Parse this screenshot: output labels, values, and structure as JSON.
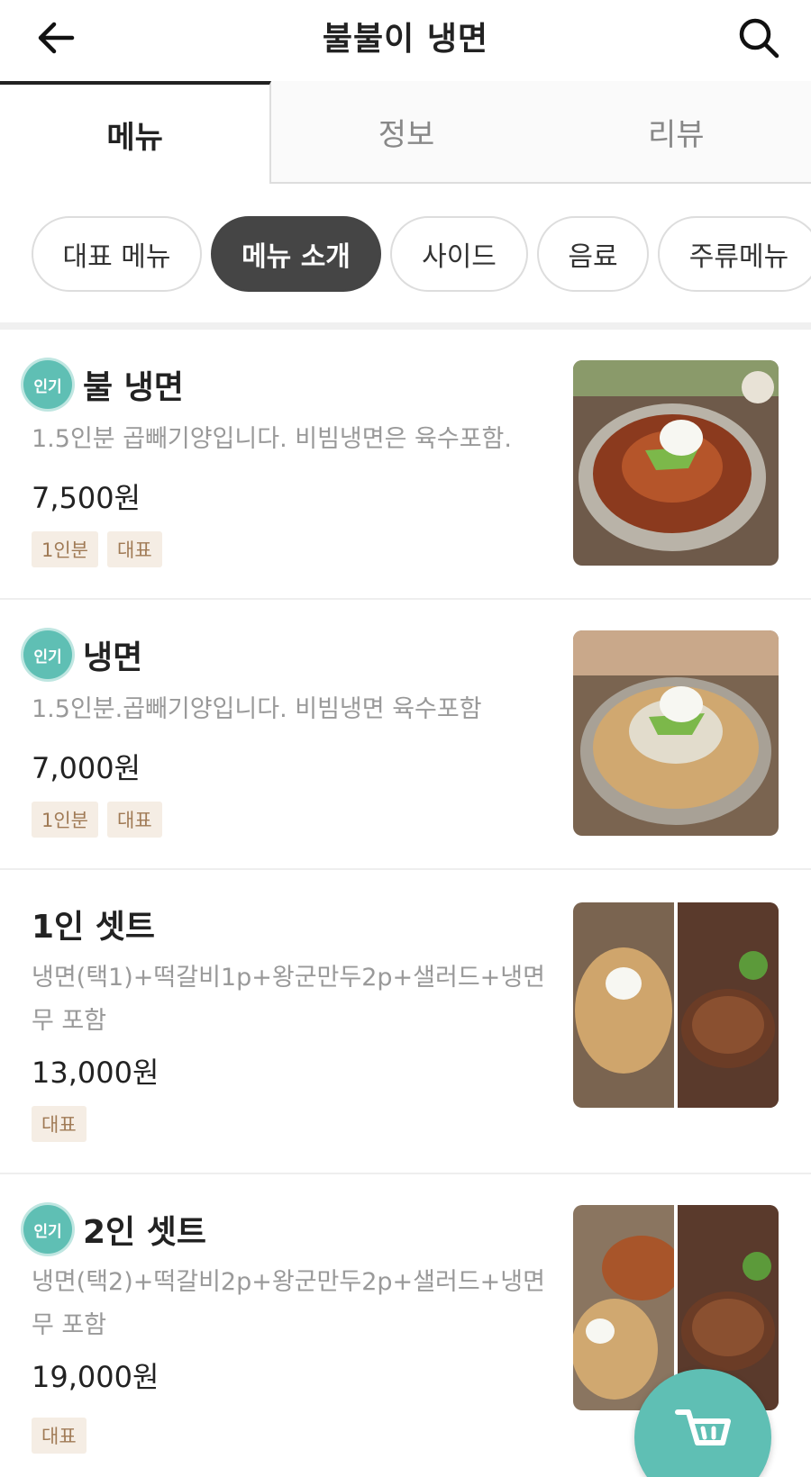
{
  "header": {
    "title": "불불이 냉면",
    "back_icon": "arrow-left-icon",
    "search_icon": "search-icon"
  },
  "tabs": [
    {
      "label": "메뉴",
      "active": true
    },
    {
      "label": "정보",
      "active": false
    },
    {
      "label": "리뷰",
      "active": false
    }
  ],
  "categories": [
    {
      "label": "대표 메뉴",
      "active": false
    },
    {
      "label": "메뉴 소개",
      "active": true
    },
    {
      "label": "사이드",
      "active": false
    },
    {
      "label": "음료",
      "active": false
    },
    {
      "label": "주류메뉴",
      "active": false
    }
  ],
  "colors": {
    "accent": "#5fbfb4",
    "chip_active": "#454545",
    "tag_bg": "#f5ede4",
    "tag_text": "#a07a55"
  },
  "menu": [
    {
      "popular": true,
      "badge": "인기",
      "name": "불 냉면",
      "desc": "1.5인분 곱빼기양입니다. 비빔냉면은 육수포함.",
      "price": "7,500원",
      "tags": [
        "1인분",
        "대표"
      ]
    },
    {
      "popular": true,
      "badge": "인기",
      "name": "냉면",
      "desc": "1.5인분.곱빼기양입니다. 비빔냉면 육수포함",
      "price": "7,000원",
      "tags": [
        "1인분",
        "대표"
      ]
    },
    {
      "popular": false,
      "badge": "",
      "name": "1인 셋트",
      "desc": "냉면(택1)+떡갈비1p+왕군만두2p+샐러드+냉면무 포함",
      "price": "13,000원",
      "tags": [
        "대표"
      ]
    },
    {
      "popular": true,
      "badge": "인기",
      "name": "2인 셋트",
      "desc": "냉면(택2)+떡갈비2p+왕군만두2p+샐러드+냉면무 포함",
      "price": "19,000원",
      "tags": [
        "대표"
      ]
    }
  ],
  "cart_icon": "cart-icon"
}
